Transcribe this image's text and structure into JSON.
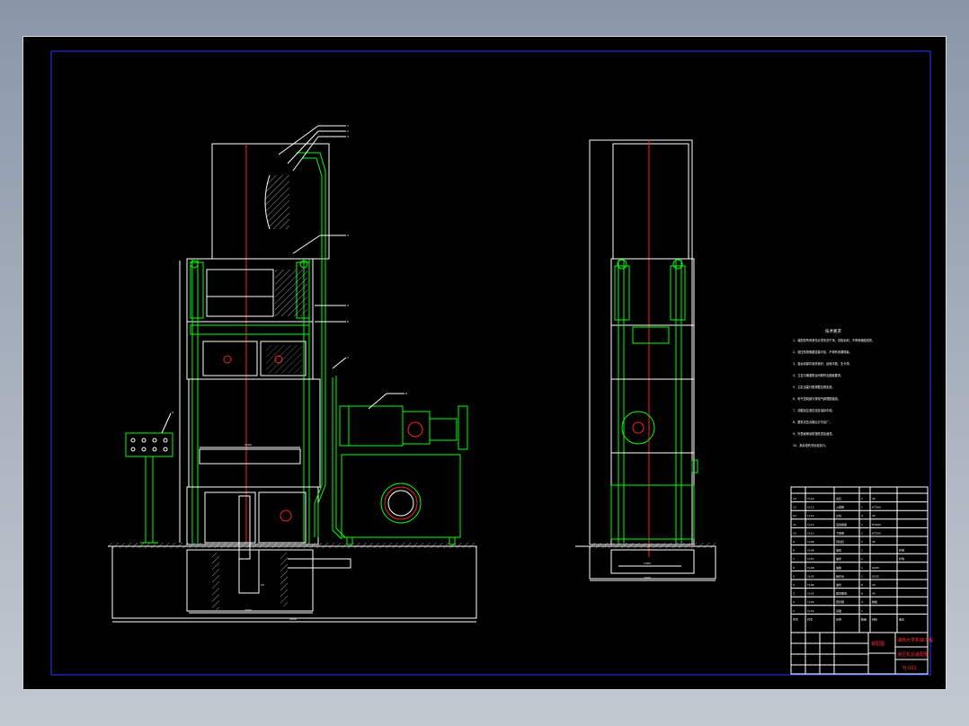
{
  "drawing": {
    "title_block": {
      "company_line1": "湖南大学机械工程",
      "company_line2": "液压机总装配图",
      "drawing_no": "YJ-001",
      "mark": "装配图"
    },
    "notes": {
      "heading": "技术要求",
      "lines": [
        "1、装配前所有零件必须清洗干净，去除毛刺，不得有磕碰划伤。",
        "2、液压系统管路连接可靠，不得有渗漏现象。",
        "3、各运动部件润滑良好，运转平稳，无卡滞。",
        "4、立柱与横梁配合间隙符合图纸要求。",
        "5、主缸活塞行程调整至规定值。",
        "6、电气控制部分按电气原理图接线。",
        "7、油箱加注液压油至油标中线。",
        "8、整机试压合格后方可出厂。",
        "9、外表面喷涂防锈底漆及面漆。",
        "10、其余按有关标准执行。"
      ]
    },
    "parts_header": [
      "序号",
      "代号",
      "名称",
      "数量",
      "材料",
      "备注"
    ],
    "parts_rows": [
      [
        "14",
        "YJ-14",
        "主缸",
        "1",
        "45",
        ""
      ],
      [
        "13",
        "YJ-13",
        "上横梁",
        "1",
        "HT200",
        ""
      ],
      [
        "12",
        "YJ-12",
        "立柱",
        "4",
        "45",
        ""
      ],
      [
        "11",
        "YJ-11",
        "活动横梁",
        "1",
        "HT200",
        ""
      ],
      [
        "10",
        "YJ-10",
        "下横梁",
        "1",
        "HT200",
        ""
      ],
      [
        "9",
        "YJ-09",
        "顶出缸",
        "1",
        "45",
        ""
      ],
      [
        "8",
        "YJ-08",
        "电机",
        "1",
        "",
        "外购"
      ],
      [
        "7",
        "YJ-07",
        "油泵",
        "1",
        "",
        "外购"
      ],
      [
        "6",
        "YJ-06",
        "油箱",
        "1",
        "Q235",
        ""
      ],
      [
        "5",
        "YJ-05",
        "操作台",
        "1",
        "Q235",
        ""
      ],
      [
        "4",
        "YJ-04",
        "油管",
        "6",
        "20",
        ""
      ],
      [
        "3",
        "YJ-03",
        "锁紧螺母",
        "8",
        "45",
        ""
      ],
      [
        "2",
        "YJ-02",
        "密封圈",
        "4",
        "橡胶",
        ""
      ],
      [
        "1",
        "YJ-01",
        "基础",
        "1",
        "",
        ""
      ]
    ],
    "dims": {
      "front_width": "3000",
      "front_inner": "1600",
      "side_width": "1800",
      "side_inner": "1400",
      "press_span": "1200",
      "foundation": "800"
    },
    "balloons": [
      "1",
      "2",
      "3",
      "4",
      "5",
      "6",
      "7",
      "8",
      "9",
      "10",
      "11"
    ]
  }
}
